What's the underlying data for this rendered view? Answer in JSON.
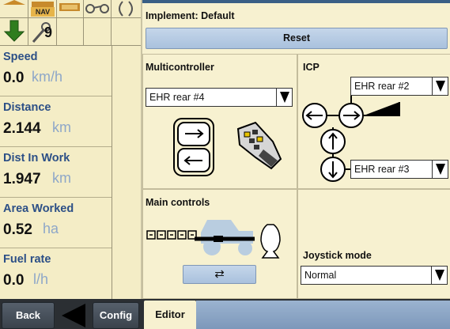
{
  "top_icons": {
    "nav_label": "NAV",
    "section_number": "9"
  },
  "metrics": [
    {
      "label": "Speed",
      "value": "0.0",
      "unit": "km/h"
    },
    {
      "label": "Distance",
      "value": "2.144",
      "unit": "km"
    },
    {
      "label": "Dist In Work",
      "value": "1.947",
      "unit": "km"
    },
    {
      "label": "Area Worked",
      "value": "0.52",
      "unit": "ha"
    },
    {
      "label": "Fuel rate",
      "value": "0.0",
      "unit": "l/h"
    }
  ],
  "implement": {
    "title": "Implement: Default",
    "reset_label": "Reset"
  },
  "multicontroller": {
    "title": "Multicontroller",
    "selected": "EHR rear #4"
  },
  "icp": {
    "title": "ICP",
    "top_selected": "EHR rear #2",
    "bottom_selected": "EHR rear #3"
  },
  "main_controls": {
    "title": "Main controls",
    "swap_symbol": "⇄"
  },
  "joystick": {
    "title": "Joystick mode",
    "selected": "Normal"
  },
  "bottom_bar": {
    "back_label": "Back",
    "config_label": "Config",
    "editor_label": "Editor"
  },
  "colors": {
    "label_blue": "#2c4f86",
    "unit_blue": "#8ea7c8",
    "panel_bg": "#f4edc6",
    "button_blue": "#b7cbe3",
    "arrow_green": "#2f7d1e"
  }
}
